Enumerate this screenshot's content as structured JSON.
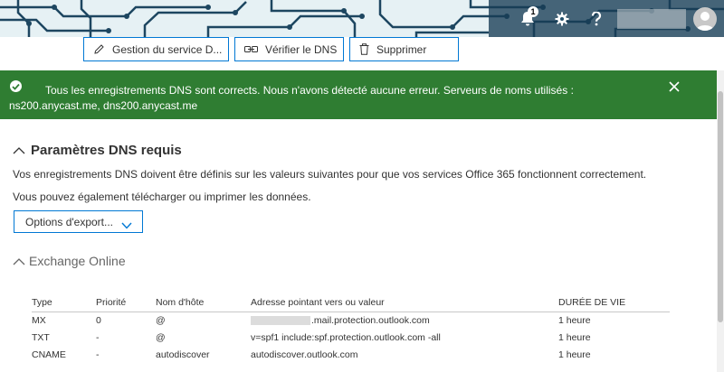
{
  "header": {
    "notification_count": "1",
    "icons": [
      "bell-icon",
      "gear-icon",
      "help-icon",
      "user-avatar-icon"
    ]
  },
  "toolbar": {
    "manage_label": "Gestion du service D...",
    "verify_label": "Vérifier le DNS",
    "delete_label": "Supprimer"
  },
  "banner": {
    "message": "Tous les enregistrements DNS sont corrects. Nous n'avons détecté aucune erreur. Serveurs de noms utilisés : ns200.anycast.me, dns200.anycast.me",
    "color": "#2f7d32"
  },
  "main": {
    "title": "Paramètres DNS requis",
    "description": "Vos enregistrements DNS doivent être définis sur les valeurs suivantes pour que vos services Office 365 fonctionnent correctement.",
    "download_text": "Vous pouvez également télécharger ou imprimer les données.",
    "export_label": "Options d'export...",
    "section_title": "Exchange Online"
  },
  "table": {
    "columns": [
      "Type",
      "Priorité",
      "Nom d'hôte",
      "Adresse pointant vers ou valeur",
      "DURÉE DE VIE"
    ],
    "rows": [
      {
        "type": "MX",
        "priority": "0",
        "host": "@",
        "value": ".mail.protection.outlook.com",
        "ttl": "1 heure"
      },
      {
        "type": "TXT",
        "priority": "-",
        "host": "@",
        "value": "v=spf1 include:spf.protection.outlook.com -all",
        "ttl": "1 heure"
      },
      {
        "type": "CNAME",
        "priority": "-",
        "host": "autodiscover",
        "value": "autodiscover.outlook.com",
        "ttl": "1 heure"
      }
    ]
  },
  "colors": {
    "accent": "#0078d4",
    "success": "#2f7d32"
  }
}
